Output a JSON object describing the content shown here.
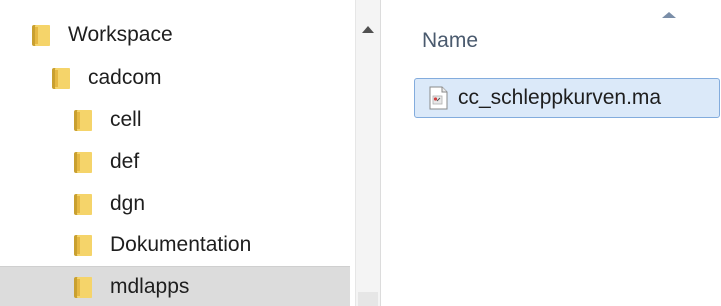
{
  "navigation": {
    "items": [
      {
        "label": "Workspace",
        "level": 0,
        "icon": "folder-icon",
        "selected": false
      },
      {
        "label": "cadcom",
        "level": 1,
        "icon": "folder-icon",
        "selected": false
      },
      {
        "label": "cell",
        "level": 2,
        "icon": "folder-icon",
        "selected": false
      },
      {
        "label": "def",
        "level": 2,
        "icon": "folder-icon",
        "selected": false
      },
      {
        "label": "dgn",
        "level": 2,
        "icon": "folder-icon",
        "selected": false
      },
      {
        "label": "Dokumentation",
        "level": 2,
        "icon": "folder-icon",
        "selected": false
      },
      {
        "label": "mdlapps",
        "level": 2,
        "icon": "folder-icon",
        "selected": true
      }
    ]
  },
  "file_list": {
    "column_header": "Name",
    "sort_direction": "ascending",
    "files": [
      {
        "name": "cc_schleppkurven.ma",
        "icon": "script-file-icon",
        "selected": true
      }
    ]
  },
  "colors": {
    "folder_light": "#f5d46a",
    "folder_dark": "#c9a030",
    "selection_blue": "#dbe9f9",
    "selection_border": "#83acdd",
    "nav_selected": "#dcdcdc"
  }
}
